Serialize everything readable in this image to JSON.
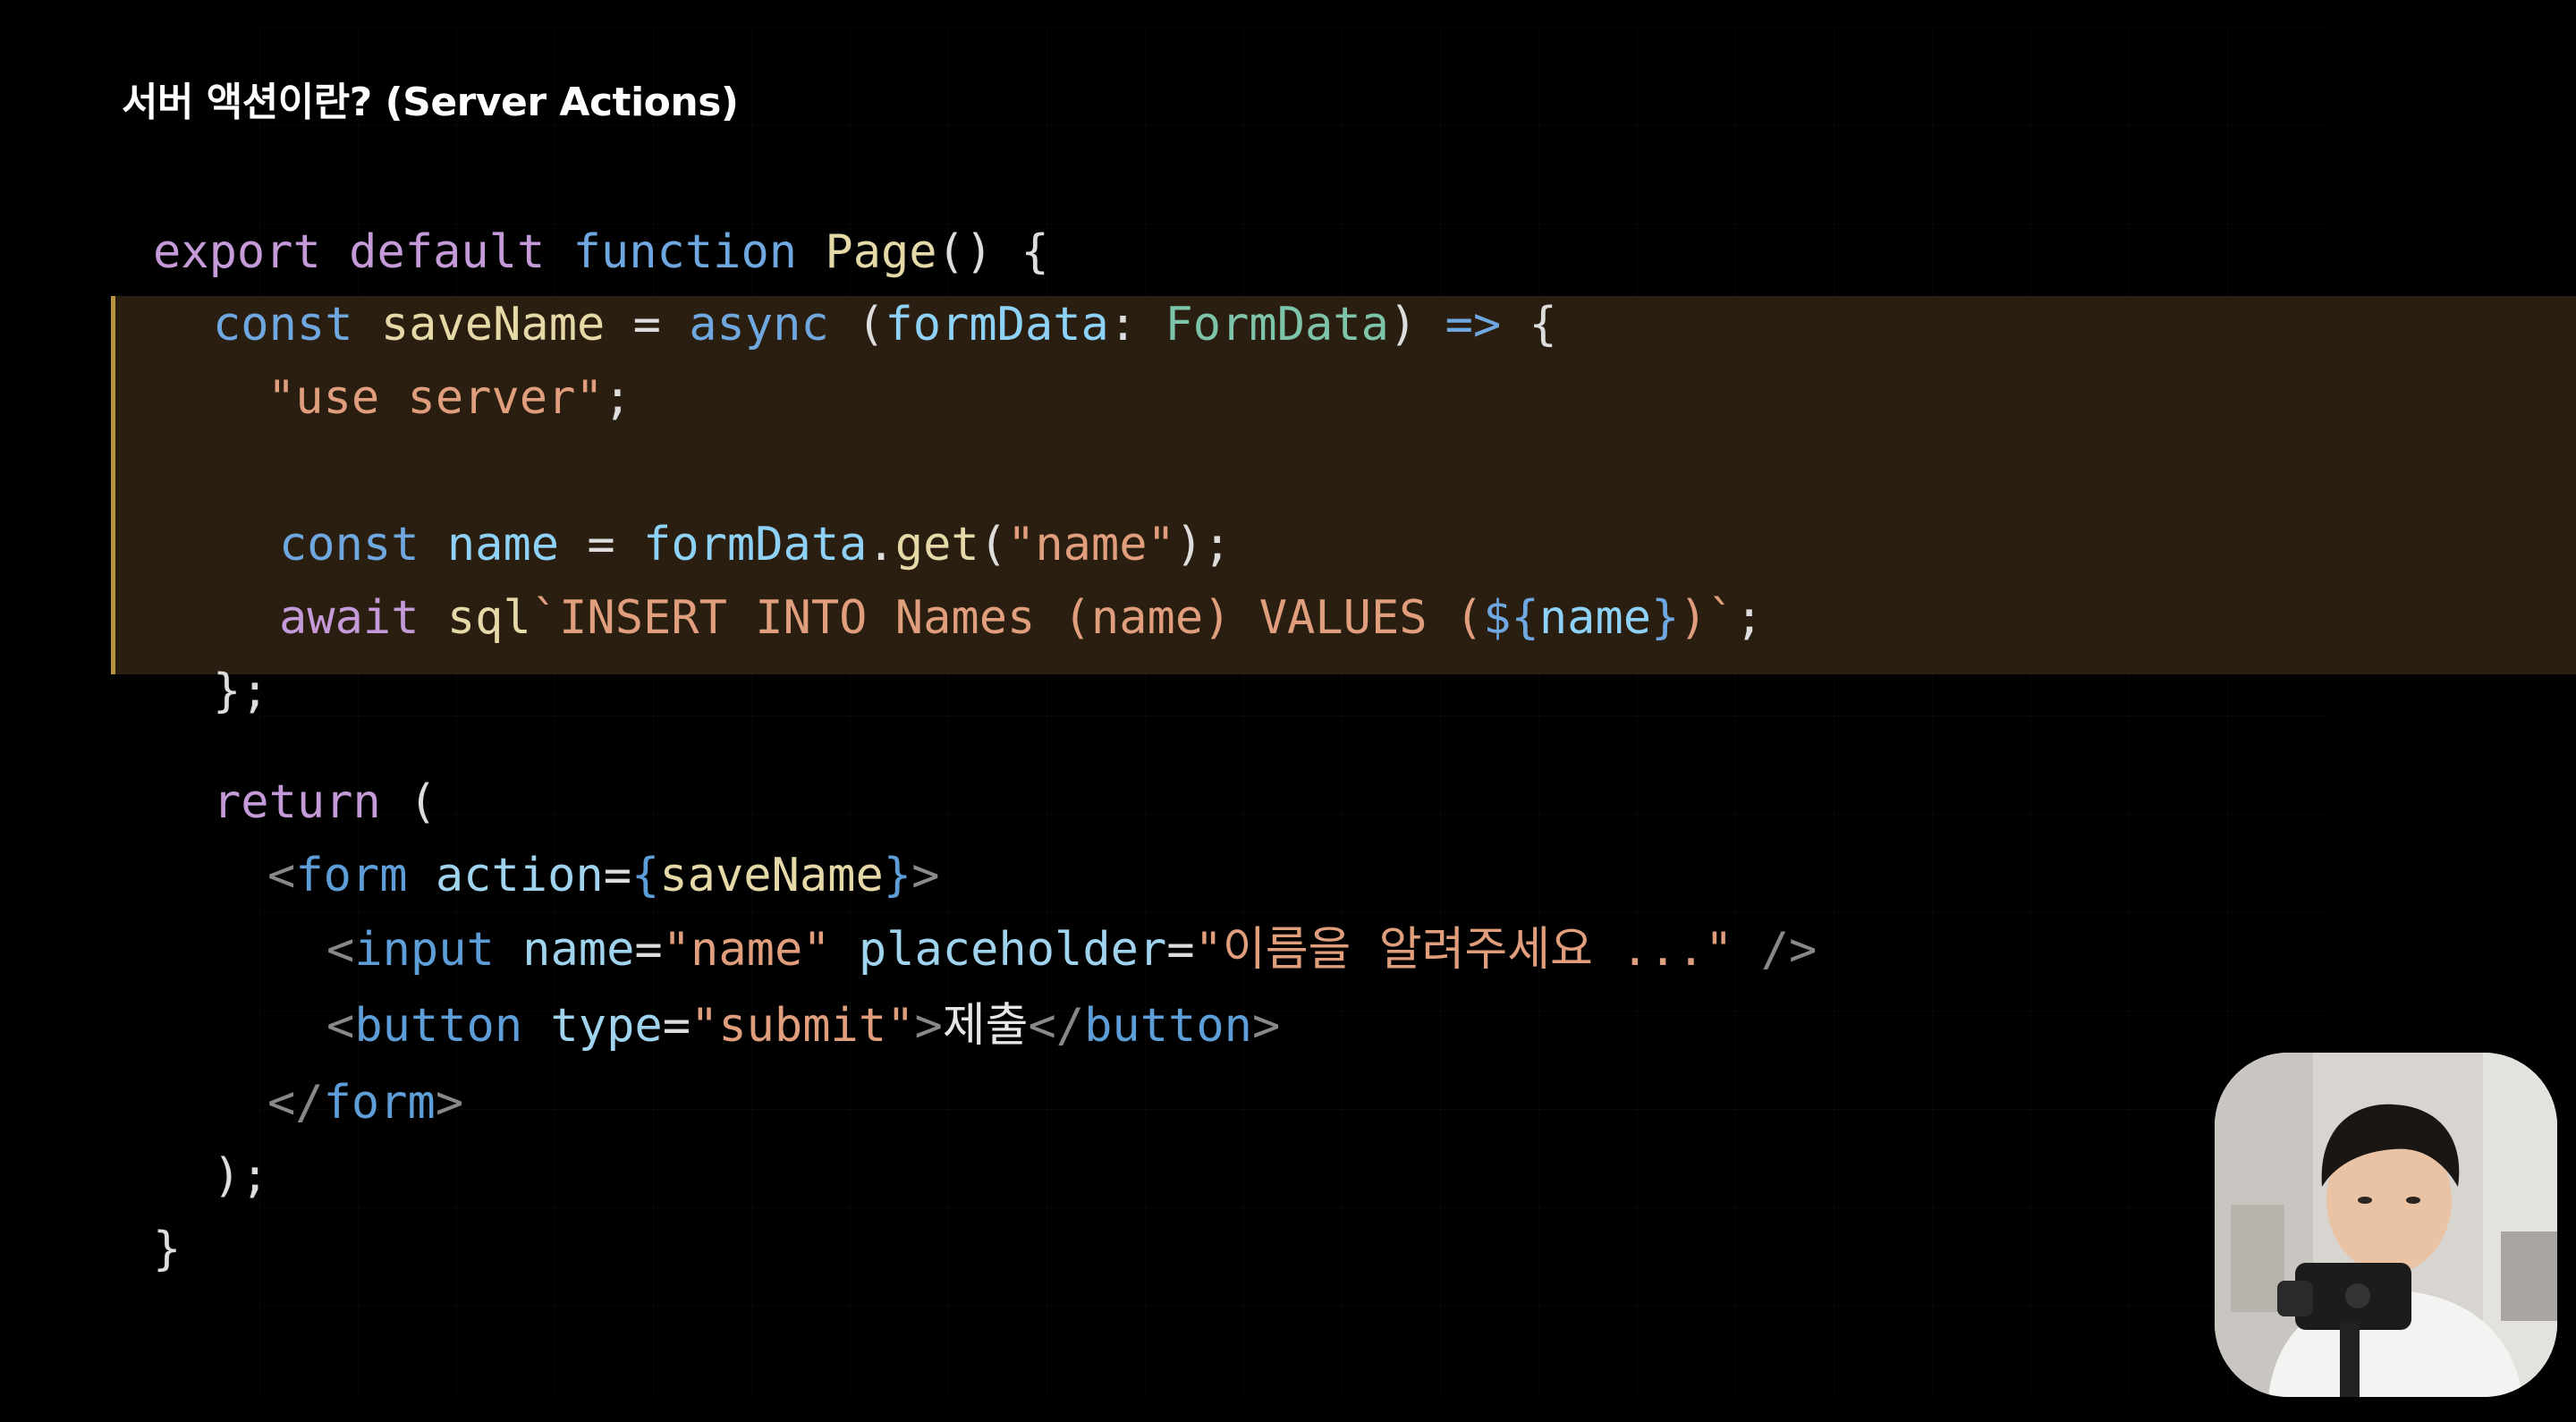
{
  "slide": {
    "title": "서버 액션이란? (Server Actions)"
  },
  "code": {
    "l1": {
      "export": "export",
      "default": "default",
      "function": "function",
      "name": "Page",
      "tail": "() {"
    },
    "l2": {
      "const": "const",
      "ident": "saveName",
      "eq": " = ",
      "async": "async",
      "open": " (",
      "param": "formData",
      "colon": ": ",
      "type": "FormData",
      "close": ") ",
      "arrow": "=>",
      "brace": " {"
    },
    "l3": {
      "str": "\"use server\"",
      "semi": ";"
    },
    "l4": {
      "const": "const",
      "ident": "name",
      "eq": " = ",
      "obj": "formData",
      "dot": ".",
      "method": "get",
      "open": "(",
      "str": "\"name\"",
      "close": ");"
    },
    "l5": {
      "await": "await",
      "tagfn": "sql",
      "tpl_start": "`INSERT INTO Names (name) VALUES (",
      "interp_open": "${",
      "interp": "name",
      "interp_close": "}",
      "tpl_end": ")`",
      "semi": ";"
    },
    "l6": {
      "text": "};"
    },
    "l7": {
      "return": "return",
      "paren": " ("
    },
    "l8": {
      "lt": "<",
      "tag": "form",
      "attr": "action",
      "eq": "=",
      "bopen": "{",
      "val": "saveName",
      "bclose": "}",
      "gt": ">"
    },
    "l9": {
      "lt": "<",
      "tag": "input",
      "attr1": "name",
      "eq1": "=",
      "val1": "\"name\"",
      "attr2": "placeholder",
      "eq2": "=",
      "val2": "\"이름을 알려주세요 ...\"",
      "end": " />"
    },
    "l10": {
      "lt": "<",
      "tag": "button",
      "attr": "type",
      "eq": "=",
      "val": "\"submit\"",
      "gt": ">",
      "text": "제출",
      "close_lt": "</",
      "close_tag": "button",
      "close_gt": ">"
    },
    "l11": {
      "lt": "</",
      "tag": "form",
      "gt": ">"
    },
    "l12": {
      "text": ");"
    },
    "l13": {
      "text": "}"
    }
  },
  "colors": {
    "background": "#000000",
    "highlight_bg": "#2a1e10",
    "highlight_border": "#b8923c",
    "keyword": "#c49ad8",
    "string": "#e09e7d",
    "type": "#7ec4aa",
    "tag": "#5d9ed8"
  },
  "webcam": {
    "icon": "presenter-video-feed"
  }
}
